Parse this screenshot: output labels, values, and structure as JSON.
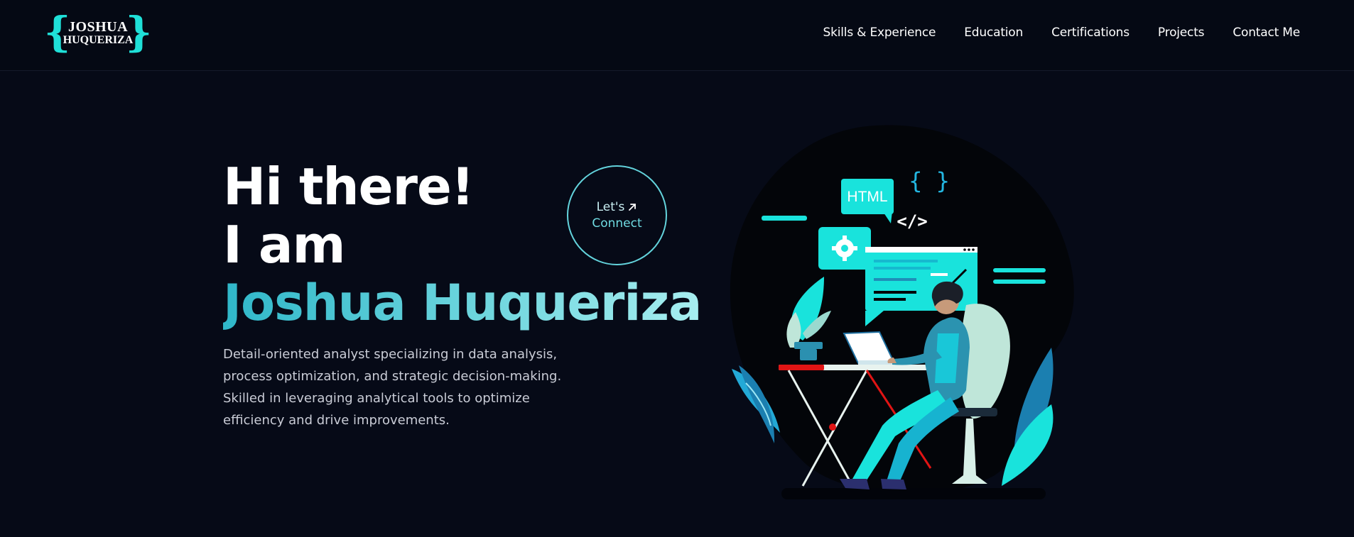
{
  "logo": {
    "line1": "JOSHUA",
    "line2": "HUQUERIZA",
    "brace_left": "{",
    "brace_right": "}",
    "accent_color": "#1fe0d8"
  },
  "nav": {
    "items": [
      {
        "label": "Skills & Experience"
      },
      {
        "label": "Education"
      },
      {
        "label": "Certifications"
      },
      {
        "label": "Projects"
      },
      {
        "label": "Contact Me"
      }
    ]
  },
  "hero": {
    "line1": "Hi there!",
    "line2": "I am",
    "name": "Joshua Huqueriza",
    "description": "Detail-oriented analyst specializing in data analysis, process optimization, and strategic decision-making. Skilled in leveraging analytical tools to optimize efficiency and drive improvements."
  },
  "connect": {
    "line1": "Let's",
    "line2": "Connect",
    "icon": "arrow-up-right-icon"
  },
  "illustration": {
    "html_badge": "HTML",
    "code_tag": "</>",
    "braces": "{ }",
    "accent": "#19e3dc",
    "background": "#030509"
  },
  "colors": {
    "background": "#060a17",
    "name_gradient_start": "#2fb7c9",
    "name_gradient_end": "#a7eef0"
  }
}
